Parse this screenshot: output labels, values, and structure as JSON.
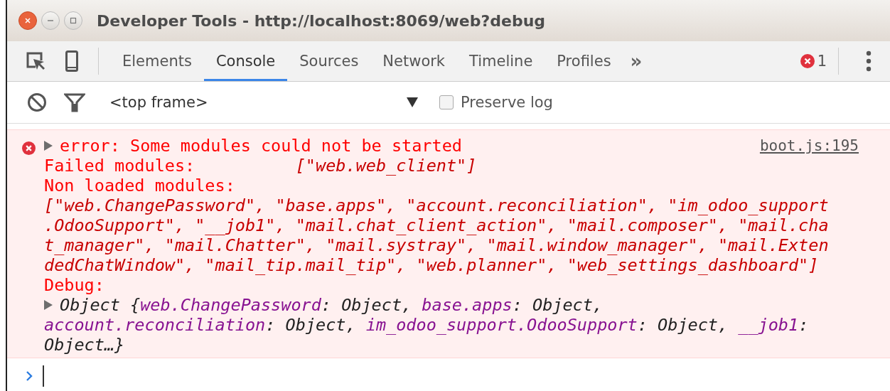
{
  "window": {
    "title": "Developer Tools - http://localhost:8069/web?debug"
  },
  "tabs": [
    {
      "label": "Elements",
      "selected": false
    },
    {
      "label": "Console",
      "selected": true
    },
    {
      "label": "Sources",
      "selected": false
    },
    {
      "label": "Network",
      "selected": false
    },
    {
      "label": "Timeline",
      "selected": false
    },
    {
      "label": "Profiles",
      "selected": false
    }
  ],
  "more_tabs": "»",
  "error_count": "1",
  "filter_bar": {
    "context": "<top frame>",
    "preserve_log": {
      "label": "Preserve log",
      "checked": false
    }
  },
  "messages": [
    {
      "kind": "error",
      "summary": "error: Some modules could not be started",
      "source": "boot.js:195",
      "failed_label": "Failed modules:",
      "failed_value": "[\"web.web_client\"]",
      "non_loaded_label": "Non loaded modules:",
      "non_loaded_lines": [
        "[\"web.ChangePassword\", \"base.apps\", \"account.reconciliation\", \"im_odoo_support",
        ".OdooSupport\", \"__job1\", \"mail.chat_client_action\", \"mail.composer\", \"mail.cha",
        "t_manager\", \"mail.Chatter\", \"mail.systray\", \"mail.window_manager\", \"mail.Exten",
        "dedChatWindow\", \"mail_tip.mail_tip\", \"web.planner\", \"web_settings_dashboard\"]"
      ],
      "debug_label": "Debug:",
      "object_lines": [
        [
          {
            "kind": "plain",
            "text": "Object {"
          },
          {
            "kind": "key",
            "text": "web.ChangePassword"
          },
          {
            "kind": "plain",
            "text": ": Object, "
          },
          {
            "kind": "key",
            "text": "base.apps"
          },
          {
            "kind": "plain",
            "text": ": Object,"
          }
        ],
        [
          {
            "kind": "key",
            "text": "account.reconciliation"
          },
          {
            "kind": "plain",
            "text": ": Object, "
          },
          {
            "kind": "key",
            "text": "im_odoo_support.OdooSupport"
          },
          {
            "kind": "plain",
            "text": ": Object, "
          },
          {
            "kind": "key",
            "text": "__job1"
          },
          {
            "kind": "plain",
            "text": ":"
          }
        ],
        [
          {
            "kind": "plain",
            "text": "Object…}"
          }
        ]
      ]
    }
  ]
}
